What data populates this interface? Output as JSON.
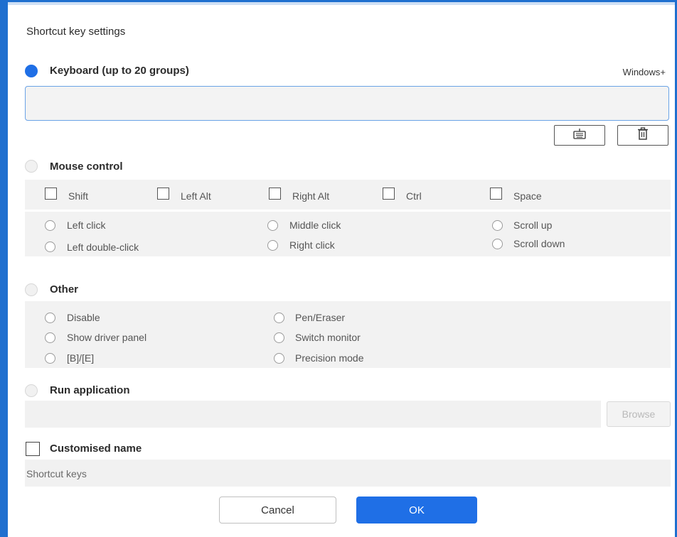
{
  "dialog": {
    "title": "Shortcut key settings"
  },
  "keyboard": {
    "label": "Keyboard (up to 20 groups)",
    "selected": true,
    "modifier_label": "Windows+",
    "input_value": "",
    "icons": [
      "keyboard-icon",
      "trash-icon"
    ]
  },
  "mouse": {
    "label": "Mouse control",
    "selected": false,
    "modifiers": [
      {
        "label": "Shift",
        "checked": false
      },
      {
        "label": "Left Alt",
        "checked": false
      },
      {
        "label": "Right Alt",
        "checked": false
      },
      {
        "label": "Ctrl",
        "checked": false
      },
      {
        "label": "Space",
        "checked": false
      }
    ],
    "actions": [
      {
        "label": "Left click"
      },
      {
        "label": "Left double-click"
      },
      {
        "label": "Middle click"
      },
      {
        "label": "Right click"
      },
      {
        "label": "Scroll up"
      },
      {
        "label": "Scroll down"
      }
    ]
  },
  "other": {
    "label": "Other",
    "selected": false,
    "options": [
      {
        "label": "Disable"
      },
      {
        "label": "Show driver panel"
      },
      {
        "label": "[B]/[E]"
      },
      {
        "label": "Pen/Eraser"
      },
      {
        "label": "Switch monitor"
      },
      {
        "label": "Precision mode"
      }
    ]
  },
  "run_app": {
    "label": "Run application",
    "selected": false,
    "path_value": "",
    "browse_label": "Browse"
  },
  "custom_name": {
    "label": "Customised name",
    "checked": false,
    "value": "Shortcut keys"
  },
  "footer": {
    "cancel_label": "Cancel",
    "ok_label": "OK"
  },
  "colors": {
    "accent": "#1f6fe6",
    "frame": "#1f6fcf",
    "panel": "#f2f2f2"
  }
}
